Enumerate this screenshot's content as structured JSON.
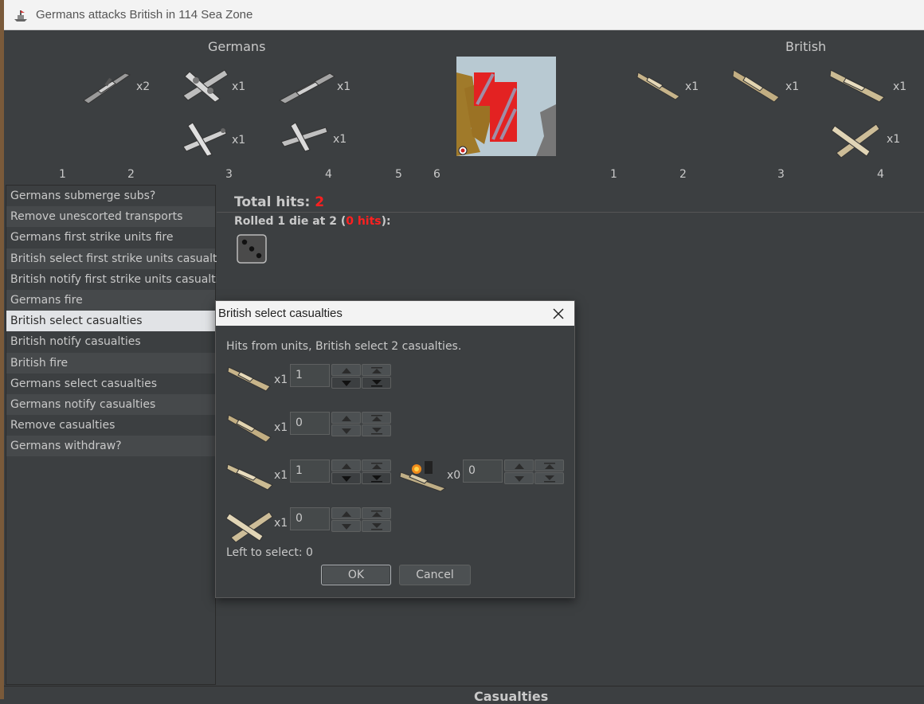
{
  "window": {
    "title": "Germans attacks British in 114 Sea Zone"
  },
  "top": {
    "germans_label": "Germans",
    "british_label": "British",
    "german_units": [
      {
        "icon": "battleship-gray",
        "count": "x2"
      },
      {
        "icon": "bomber-gray",
        "count": "x1"
      },
      {
        "icon": "cruiser-gray",
        "count": "x1"
      },
      {
        "icon": "fighter-gray",
        "count": "x1"
      },
      {
        "icon": "tactical-bomber-gray",
        "count": "x1"
      }
    ],
    "british_units": [
      {
        "icon": "destroyer-tan",
        "count": "x1"
      },
      {
        "icon": "cruiser-tan",
        "count": "x1"
      },
      {
        "icon": "battleship-tan",
        "count": "x1"
      },
      {
        "icon": "fighter-tan",
        "count": "x1"
      }
    ],
    "german_dice_axis": [
      "1",
      "2",
      "3",
      "4",
      "5",
      "6"
    ],
    "british_dice_axis": [
      "1",
      "2",
      "3",
      "4"
    ]
  },
  "steps": [
    "Germans submerge subs?",
    "Remove unescorted transports",
    "Germans first strike units fire",
    "British select first strike units casualties",
    "British notify first strike units casualties",
    "Germans fire",
    "British select casualties",
    "British notify casualties",
    "British fire",
    "Germans select casualties",
    "Germans notify casualties",
    "Remove casualties",
    "Germans withdraw?"
  ],
  "selected_step": "British select casualties",
  "results": {
    "total_label": "Total hits: ",
    "total_value": "2",
    "rolled_prefix": "Rolled 1 die at 2 (",
    "rolled_hits": "0 hits",
    "rolled_suffix": "):",
    "die_value": 3
  },
  "dialog": {
    "title": "British select casualties",
    "message": "Hits from units,  British select 2 casualties.",
    "rows": [
      {
        "icon": "destroyer-tan",
        "count": "x1",
        "value": "1"
      },
      {
        "icon": "cruiser-tan",
        "count": "x1",
        "value": "0"
      },
      {
        "icon": "battleship-tan",
        "count": "x1",
        "value": "1"
      },
      {
        "icon": "damaged-battleship",
        "count": "x0",
        "value": "0"
      },
      {
        "icon": "fighter-tan",
        "count": "x1",
        "value": "0"
      }
    ],
    "left_to_select": "Left to select: 0",
    "ok_label": "OK",
    "cancel_label": "Cancel"
  },
  "bottom": {
    "label": "Casualties"
  },
  "colors": {
    "accent_red": "#ff2020",
    "selected_bg": "#e1e3e6",
    "panel_bg": "#3c3f41"
  }
}
